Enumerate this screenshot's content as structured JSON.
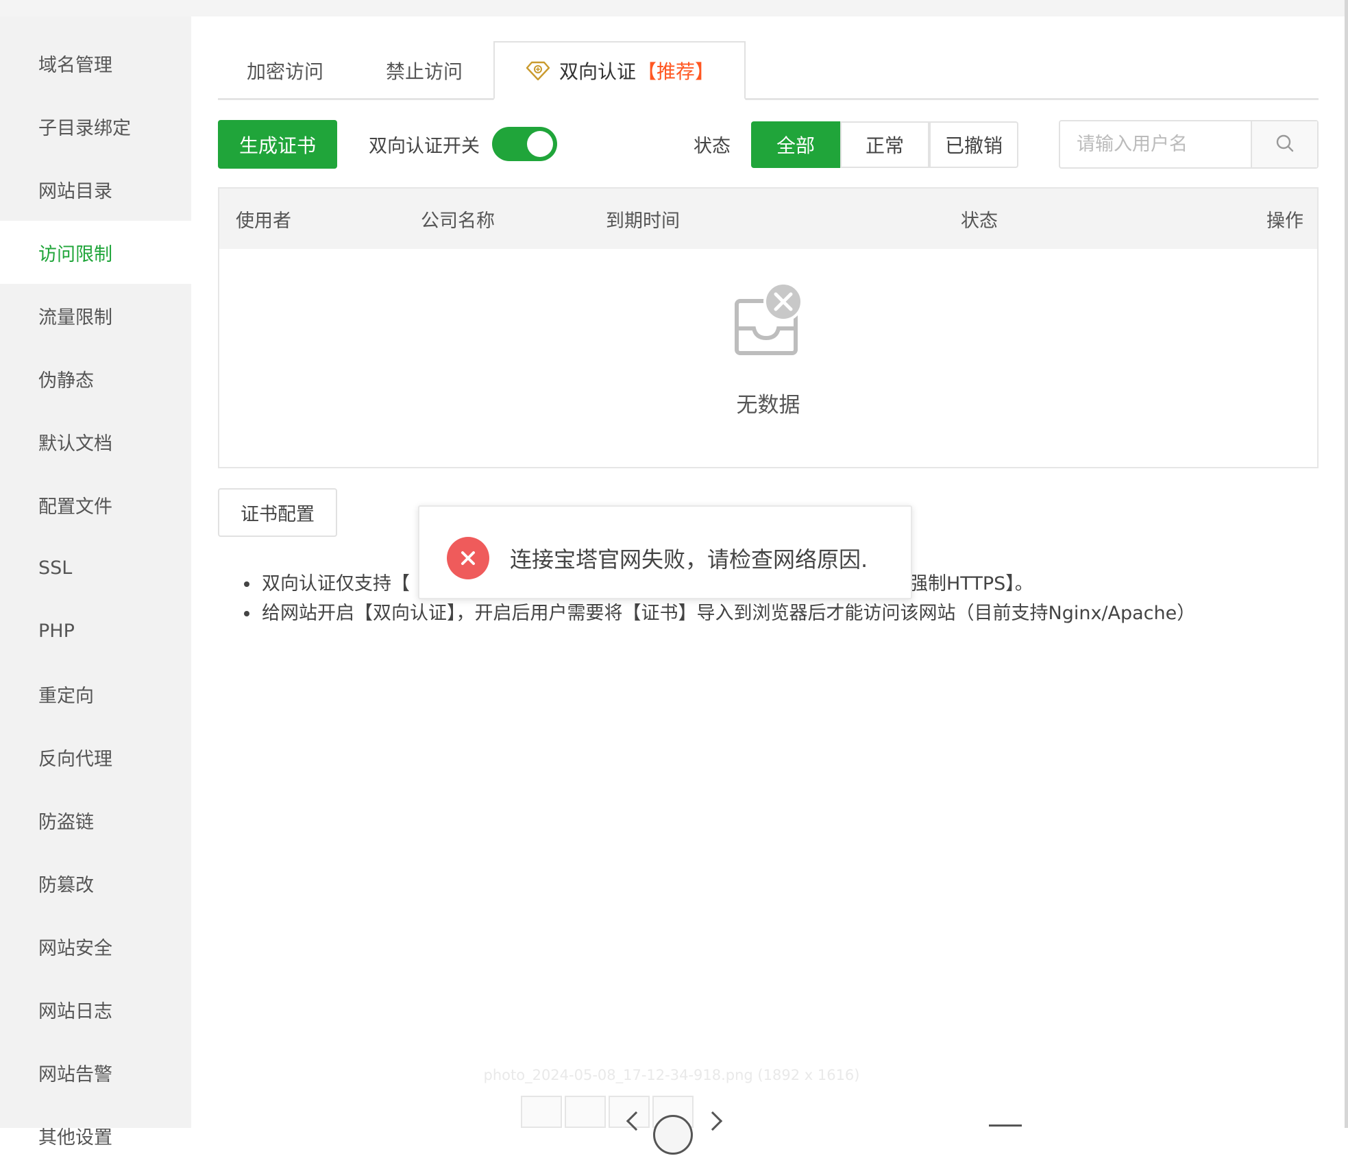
{
  "sidebar": {
    "items": [
      {
        "label": "域名管理"
      },
      {
        "label": "子目录绑定"
      },
      {
        "label": "网站目录"
      },
      {
        "label": "访问限制"
      },
      {
        "label": "流量限制"
      },
      {
        "label": "伪静态"
      },
      {
        "label": "默认文档"
      },
      {
        "label": "配置文件"
      },
      {
        "label": "SSL"
      },
      {
        "label": "PHP"
      },
      {
        "label": "重定向"
      },
      {
        "label": "反向代理"
      },
      {
        "label": "防盗链"
      },
      {
        "label": "防篡改"
      },
      {
        "label": "网站安全"
      },
      {
        "label": "网站日志"
      },
      {
        "label": "网站告警"
      },
      {
        "label": "其他设置"
      }
    ],
    "active_label": "访问限制"
  },
  "tabs": [
    {
      "label": "加密访问"
    },
    {
      "label": "禁止访问"
    },
    {
      "label": "双向认证",
      "suffix": "【推荐】",
      "icon": "diamond-icon"
    }
  ],
  "toolbar": {
    "generate_cert": "生成证书",
    "toggle_label": "双向认证开关",
    "toggle_on": true,
    "status_label": "状态",
    "status_options": [
      "全部",
      "正常",
      "已撤销"
    ],
    "status_selected": "全部",
    "search_placeholder": "请输入用户名"
  },
  "table": {
    "columns": [
      "使用者",
      "公司名称",
      "到期时间",
      "状态",
      "操作"
    ],
    "rows": [],
    "empty_text": "无数据"
  },
  "cert_config_button": "证书配置",
  "notes": [
    "双向认证仅支持【",
    "强制HTTPS】。",
    "给网站开启【双向认证】，开启后用户需要将【证书】导入到浏览器后才能访问该网站（目前支持Nginx/Apache）"
  ],
  "toast": {
    "message": "连接宝塔官网失败，请检查网络原因.",
    "icon": "error-icon"
  },
  "viewer": {
    "caption": "photo_2024-05-08_17-12-34-918.png (1892 x 1616)"
  },
  "colors": {
    "accent": "#20a53a",
    "recommend": "#ff5722",
    "error": "#ef5b5b"
  }
}
